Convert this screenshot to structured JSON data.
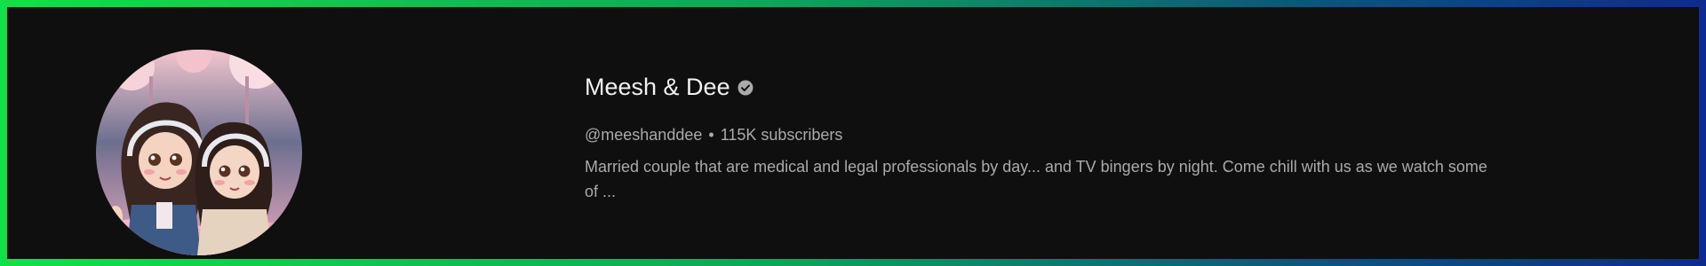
{
  "channel": {
    "name": "Meesh & Dee",
    "verified_icon": "verified-check-icon",
    "handle": "@meeshanddee",
    "separator": "•",
    "subscribers": "115K subscribers",
    "description": "Married couple that are medical and legal professionals by day... and TV bingers by night. Come chill with us as we watch some of ..."
  },
  "colors": {
    "background": "#0f0f0f",
    "title_text": "#f1f1f1",
    "secondary_text": "#aaaaaa",
    "border_gradient_start": "#12e047",
    "border_gradient_end": "#0f2a8f"
  }
}
